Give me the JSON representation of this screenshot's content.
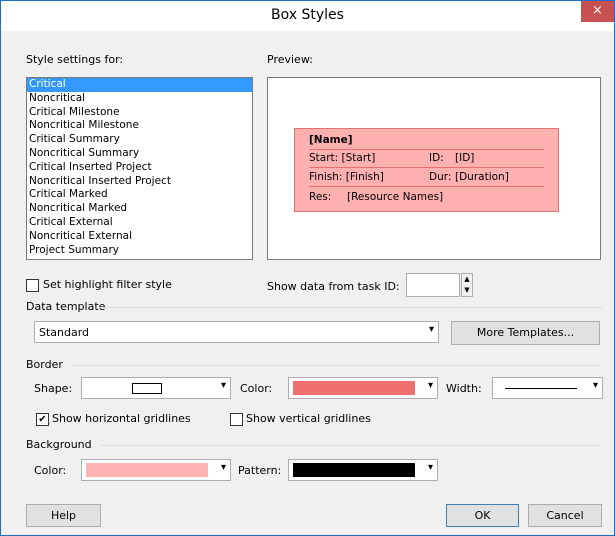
{
  "window": {
    "title": "Box Styles",
    "close_glyph": "×"
  },
  "style_settings": {
    "label": "Style settings for:",
    "items": [
      "Critical",
      "Noncritical",
      "Critical Milestone",
      "Noncritical Milestone",
      "Critical Summary",
      "Noncritical Summary",
      "Critical Inserted Project",
      "Noncritical Inserted Project",
      "Critical Marked",
      "Noncritical Marked",
      "Critical External",
      "Noncritical External",
      "Project Summary"
    ],
    "selected": "Critical"
  },
  "preview": {
    "label": "Preview:",
    "name": "[Name]",
    "start_label": "Start:",
    "start_value": "[Start]",
    "id_label": "ID:",
    "id_value": "[ID]",
    "finish_label": "Finish:",
    "finish_value": "[Finish]",
    "dur_label": "Dur:",
    "dur_value": "[Duration]",
    "res_label": "Res:",
    "res_value": "[Resource Names]"
  },
  "highlight": {
    "label": "Set highlight filter style",
    "checked": false
  },
  "show_data": {
    "label": "Show data from task ID:",
    "value": ""
  },
  "data_template": {
    "label": "Data template",
    "value": "Standard",
    "more_button": "More Templates..."
  },
  "border": {
    "label": "Border",
    "shape_label": "Shape:",
    "color_label": "Color:",
    "color_value": "#f07070",
    "width_label": "Width:",
    "show_horizontal": {
      "label": "Show horizontal gridlines",
      "checked": true
    },
    "show_vertical": {
      "label": "Show vertical gridlines",
      "checked": false
    }
  },
  "background": {
    "label": "Background",
    "color_label": "Color:",
    "color_value": "#ffb3b3",
    "pattern_label": "Pattern:",
    "pattern_value": "#000000"
  },
  "buttons": {
    "help": "Help",
    "ok": "OK",
    "cancel": "Cancel"
  },
  "icons": {
    "dropdown": "chevron-down-icon",
    "check": "check-icon",
    "close": "close-icon"
  },
  "colors": {
    "selection": "#3399ff",
    "preview_fill": "#ffb0b0",
    "preview_border": "#e87070"
  }
}
